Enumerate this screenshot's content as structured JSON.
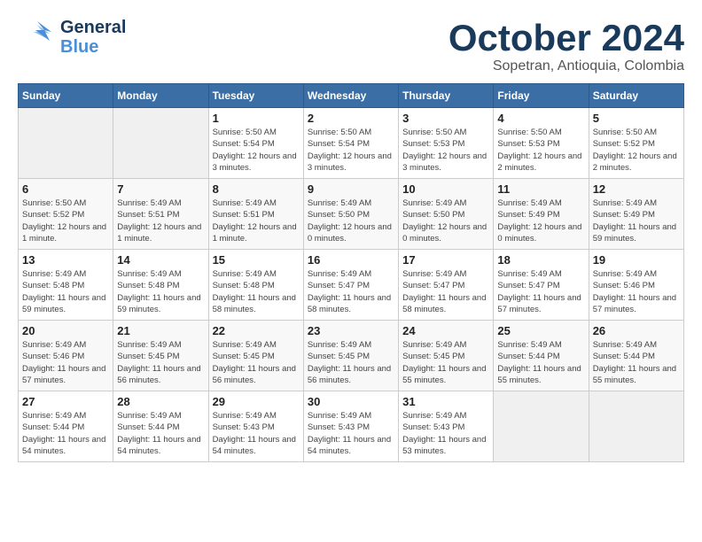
{
  "header": {
    "logo_general": "General",
    "logo_blue": "Blue",
    "month_title": "October 2024",
    "subtitle": "Sopetran, Antioquia, Colombia"
  },
  "weekdays": [
    "Sunday",
    "Monday",
    "Tuesday",
    "Wednesday",
    "Thursday",
    "Friday",
    "Saturday"
  ],
  "weeks": [
    [
      {
        "day": "",
        "sunrise": "",
        "sunset": "",
        "daylight": ""
      },
      {
        "day": "",
        "sunrise": "",
        "sunset": "",
        "daylight": ""
      },
      {
        "day": "1",
        "sunrise": "Sunrise: 5:50 AM",
        "sunset": "Sunset: 5:54 PM",
        "daylight": "Daylight: 12 hours and 3 minutes."
      },
      {
        "day": "2",
        "sunrise": "Sunrise: 5:50 AM",
        "sunset": "Sunset: 5:54 PM",
        "daylight": "Daylight: 12 hours and 3 minutes."
      },
      {
        "day": "3",
        "sunrise": "Sunrise: 5:50 AM",
        "sunset": "Sunset: 5:53 PM",
        "daylight": "Daylight: 12 hours and 3 minutes."
      },
      {
        "day": "4",
        "sunrise": "Sunrise: 5:50 AM",
        "sunset": "Sunset: 5:53 PM",
        "daylight": "Daylight: 12 hours and 2 minutes."
      },
      {
        "day": "5",
        "sunrise": "Sunrise: 5:50 AM",
        "sunset": "Sunset: 5:52 PM",
        "daylight": "Daylight: 12 hours and 2 minutes."
      }
    ],
    [
      {
        "day": "6",
        "sunrise": "Sunrise: 5:50 AM",
        "sunset": "Sunset: 5:52 PM",
        "daylight": "Daylight: 12 hours and 1 minute."
      },
      {
        "day": "7",
        "sunrise": "Sunrise: 5:49 AM",
        "sunset": "Sunset: 5:51 PM",
        "daylight": "Daylight: 12 hours and 1 minute."
      },
      {
        "day": "8",
        "sunrise": "Sunrise: 5:49 AM",
        "sunset": "Sunset: 5:51 PM",
        "daylight": "Daylight: 12 hours and 1 minute."
      },
      {
        "day": "9",
        "sunrise": "Sunrise: 5:49 AM",
        "sunset": "Sunset: 5:50 PM",
        "daylight": "Daylight: 12 hours and 0 minutes."
      },
      {
        "day": "10",
        "sunrise": "Sunrise: 5:49 AM",
        "sunset": "Sunset: 5:50 PM",
        "daylight": "Daylight: 12 hours and 0 minutes."
      },
      {
        "day": "11",
        "sunrise": "Sunrise: 5:49 AM",
        "sunset": "Sunset: 5:49 PM",
        "daylight": "Daylight: 12 hours and 0 minutes."
      },
      {
        "day": "12",
        "sunrise": "Sunrise: 5:49 AM",
        "sunset": "Sunset: 5:49 PM",
        "daylight": "Daylight: 11 hours and 59 minutes."
      }
    ],
    [
      {
        "day": "13",
        "sunrise": "Sunrise: 5:49 AM",
        "sunset": "Sunset: 5:48 PM",
        "daylight": "Daylight: 11 hours and 59 minutes."
      },
      {
        "day": "14",
        "sunrise": "Sunrise: 5:49 AM",
        "sunset": "Sunset: 5:48 PM",
        "daylight": "Daylight: 11 hours and 59 minutes."
      },
      {
        "day": "15",
        "sunrise": "Sunrise: 5:49 AM",
        "sunset": "Sunset: 5:48 PM",
        "daylight": "Daylight: 11 hours and 58 minutes."
      },
      {
        "day": "16",
        "sunrise": "Sunrise: 5:49 AM",
        "sunset": "Sunset: 5:47 PM",
        "daylight": "Daylight: 11 hours and 58 minutes."
      },
      {
        "day": "17",
        "sunrise": "Sunrise: 5:49 AM",
        "sunset": "Sunset: 5:47 PM",
        "daylight": "Daylight: 11 hours and 58 minutes."
      },
      {
        "day": "18",
        "sunrise": "Sunrise: 5:49 AM",
        "sunset": "Sunset: 5:47 PM",
        "daylight": "Daylight: 11 hours and 57 minutes."
      },
      {
        "day": "19",
        "sunrise": "Sunrise: 5:49 AM",
        "sunset": "Sunset: 5:46 PM",
        "daylight": "Daylight: 11 hours and 57 minutes."
      }
    ],
    [
      {
        "day": "20",
        "sunrise": "Sunrise: 5:49 AM",
        "sunset": "Sunset: 5:46 PM",
        "daylight": "Daylight: 11 hours and 57 minutes."
      },
      {
        "day": "21",
        "sunrise": "Sunrise: 5:49 AM",
        "sunset": "Sunset: 5:45 PM",
        "daylight": "Daylight: 11 hours and 56 minutes."
      },
      {
        "day": "22",
        "sunrise": "Sunrise: 5:49 AM",
        "sunset": "Sunset: 5:45 PM",
        "daylight": "Daylight: 11 hours and 56 minutes."
      },
      {
        "day": "23",
        "sunrise": "Sunrise: 5:49 AM",
        "sunset": "Sunset: 5:45 PM",
        "daylight": "Daylight: 11 hours and 56 minutes."
      },
      {
        "day": "24",
        "sunrise": "Sunrise: 5:49 AM",
        "sunset": "Sunset: 5:45 PM",
        "daylight": "Daylight: 11 hours and 55 minutes."
      },
      {
        "day": "25",
        "sunrise": "Sunrise: 5:49 AM",
        "sunset": "Sunset: 5:44 PM",
        "daylight": "Daylight: 11 hours and 55 minutes."
      },
      {
        "day": "26",
        "sunrise": "Sunrise: 5:49 AM",
        "sunset": "Sunset: 5:44 PM",
        "daylight": "Daylight: 11 hours and 55 minutes."
      }
    ],
    [
      {
        "day": "27",
        "sunrise": "Sunrise: 5:49 AM",
        "sunset": "Sunset: 5:44 PM",
        "daylight": "Daylight: 11 hours and 54 minutes."
      },
      {
        "day": "28",
        "sunrise": "Sunrise: 5:49 AM",
        "sunset": "Sunset: 5:44 PM",
        "daylight": "Daylight: 11 hours and 54 minutes."
      },
      {
        "day": "29",
        "sunrise": "Sunrise: 5:49 AM",
        "sunset": "Sunset: 5:43 PM",
        "daylight": "Daylight: 11 hours and 54 minutes."
      },
      {
        "day": "30",
        "sunrise": "Sunrise: 5:49 AM",
        "sunset": "Sunset: 5:43 PM",
        "daylight": "Daylight: 11 hours and 54 minutes."
      },
      {
        "day": "31",
        "sunrise": "Sunrise: 5:49 AM",
        "sunset": "Sunset: 5:43 PM",
        "daylight": "Daylight: 11 hours and 53 minutes."
      },
      {
        "day": "",
        "sunrise": "",
        "sunset": "",
        "daylight": ""
      },
      {
        "day": "",
        "sunrise": "",
        "sunset": "",
        "daylight": ""
      }
    ]
  ]
}
